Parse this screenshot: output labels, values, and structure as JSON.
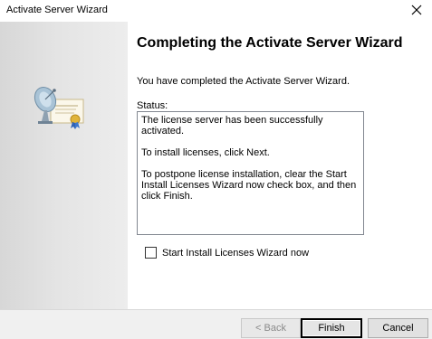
{
  "window": {
    "title": "Activate Server Wizard"
  },
  "icons": {
    "close": "close-icon",
    "banner": "satellite-dish-certificate-icon"
  },
  "content": {
    "heading": "Completing the Activate Server Wizard",
    "subtext": "You have completed the Activate Server Wizard.",
    "status_label": "Status:",
    "status_lines": [
      "The license server has been successfully activated.",
      "To install licenses, click Next.",
      "To postpone license installation, clear the Start Install Licenses Wizard now check box, and then click Finish."
    ],
    "checkbox_label": "Start Install Licenses Wizard now",
    "checkbox_checked": false
  },
  "buttons": {
    "back": "< Back",
    "finish": "Finish",
    "cancel": "Cancel"
  },
  "colors": {
    "focus_border": "#000000",
    "footer_bg": "#f0f0f0",
    "banner_bg": "#e4e4e4"
  }
}
